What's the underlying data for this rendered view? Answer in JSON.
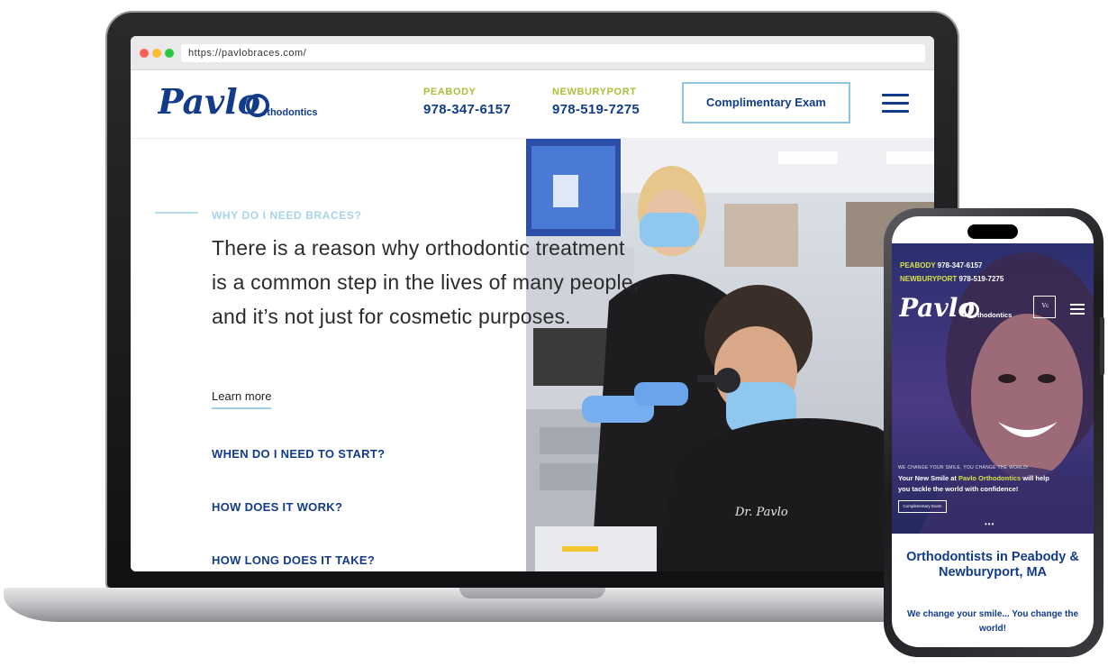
{
  "browser": {
    "url": "https://pavlobraces.com/"
  },
  "site": {
    "logo": {
      "brand": "Pavlo",
      "suffix": "rthodontics"
    },
    "locations": [
      {
        "name": "PEABODY",
        "phone": "978-347-6157"
      },
      {
        "name": "NEWBURYPORT",
        "phone": "978-519-7275"
      }
    ],
    "cta_label": "Complimentary Exam"
  },
  "content": {
    "eyebrow": "WHY DO I NEED BRACES?",
    "headline": "There is a reason why orthodontic treatment is a common step in the lives of many people, and it’s not just for cosmetic purposes.",
    "learn_more": "Learn more",
    "faq": [
      "WHEN DO I NEED TO START?",
      "HOW DOES IT WORK?",
      "HOW LONG DOES IT TAKE?"
    ]
  },
  "mobile": {
    "locations": [
      {
        "name": "PEABODY",
        "phone": "978-347-6157"
      },
      {
        "name": "NEWBURYPORT",
        "phone": "978-519-7275"
      }
    ],
    "logo": {
      "brand": "Pavlo",
      "suffix": "rthodontics"
    },
    "badge": "Vc",
    "tagline_small": "WE CHANGE YOUR SMILE, YOU CHANGE THE WORLD!",
    "subhead_pre": "Your New Smile at ",
    "subhead_brand": "Pavlo Orthodontics",
    "subhead_post": " will help you tackle the world with confidence!",
    "cta_label": "Complimentary Exam",
    "carousel_dots": "•••",
    "section_title": "Orthodontists in Peabody & Newburyport, MA",
    "section_tagline": "We change your smile... You change the world!"
  },
  "colors": {
    "brand_blue": "#123b8a",
    "accent_green": "#a6c23a",
    "light_blue": "#8fc3e0"
  },
  "icons": {
    "menu": "hamburger-icon",
    "window_controls": [
      "close-dot",
      "minimize-dot",
      "maximize-dot"
    ]
  }
}
